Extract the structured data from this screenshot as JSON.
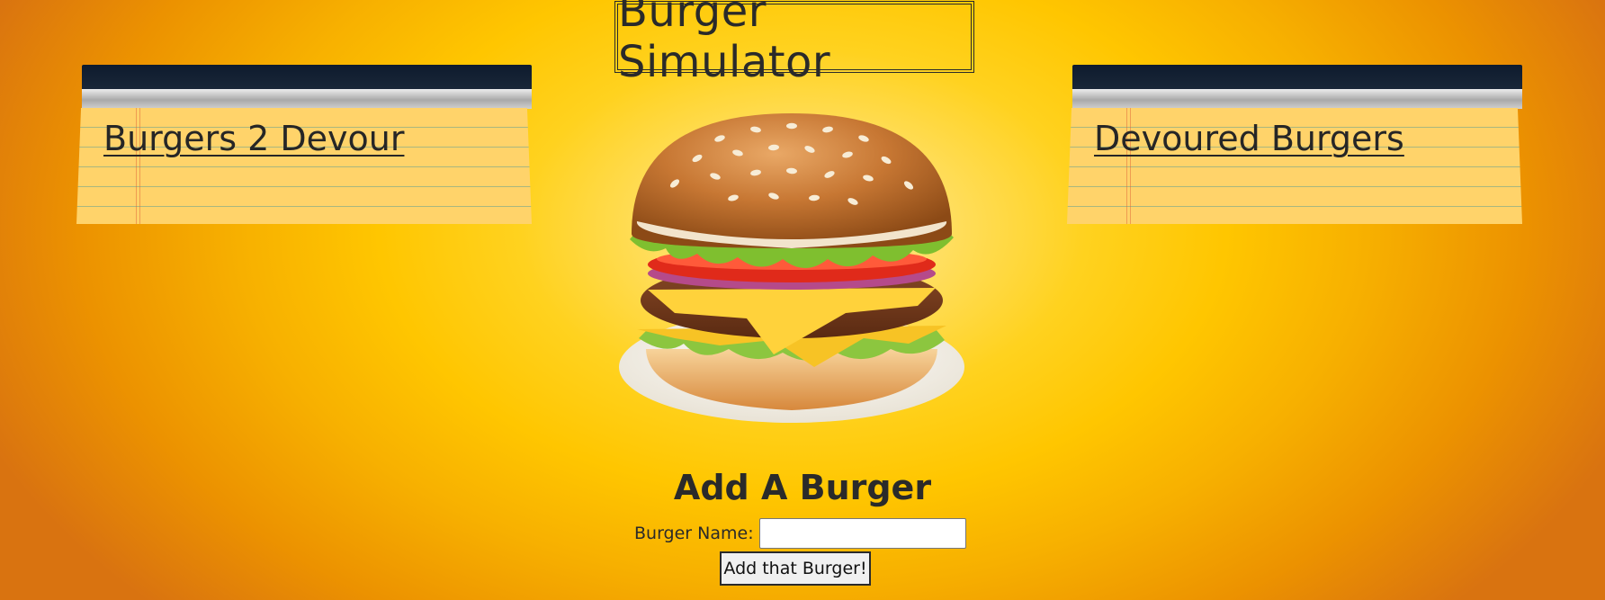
{
  "header": {
    "title": "Burger Simulator"
  },
  "lists": {
    "to_devour": {
      "heading": "Burgers 2 Devour",
      "items": []
    },
    "devoured": {
      "heading": "Devoured Burgers",
      "items": []
    }
  },
  "hero": {
    "icon": "burger-image"
  },
  "form": {
    "heading": "Add A Burger",
    "name_label": "Burger Name:",
    "name_value": "",
    "submit_label": "Add that Burger!"
  }
}
